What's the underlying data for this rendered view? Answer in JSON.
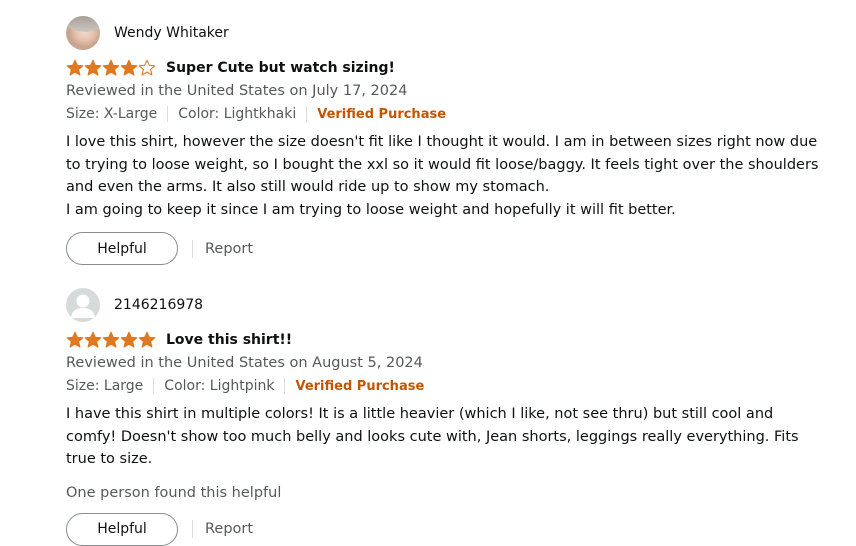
{
  "reviews": [
    {
      "author": "Wendy Whitaker",
      "avatar": "profile-photo",
      "rating": 4,
      "rating_max": 5,
      "title": "Super Cute but watch sizing!",
      "date_line": "Reviewed in the United States on July 17, 2024",
      "size": "Size: X-Large",
      "color": "Color: Lightkhaki",
      "verified": "Verified Purchase",
      "body": [
        "I love this shirt, however the size doesn't fit like I thought it would. I am in between sizes right now due to trying to loose weight, so I bought the xxl so it would fit loose/baggy. It feels tight over the shoulders and even the arms. It also still would ride up to show my stomach.",
        "I am going to keep it since I am trying to loose weight and hopefully it will fit better."
      ],
      "helpful_label": "Helpful",
      "report_label": "Report"
    },
    {
      "author": "2146216978",
      "avatar": "generic-user-icon",
      "rating": 5,
      "rating_max": 5,
      "title": "Love this shirt!!",
      "date_line": "Reviewed in the United States on August 5, 2024",
      "size": "Size: Large",
      "color": "Color: Lightpink",
      "verified": "Verified Purchase",
      "body": [
        "I have this shirt in multiple colors! It is a little heavier (which I like, not see thru) but still cool and comfy! Doesn't show too much belly and looks cute with, Jean shorts, leggings really everything. Fits true to size."
      ],
      "helpful_count": "One person found this helpful",
      "helpful_label": "Helpful",
      "report_label": "Report"
    }
  ],
  "colors": {
    "star": "#de7921",
    "verified": "#c45500",
    "secondary_text": "#565959"
  }
}
